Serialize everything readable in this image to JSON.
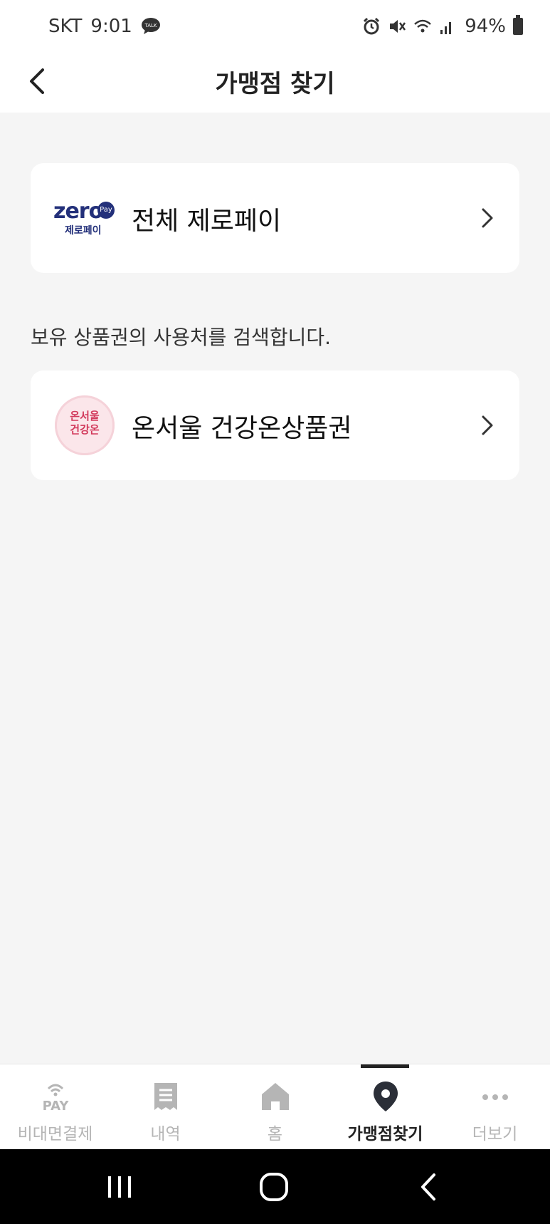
{
  "status_bar": {
    "carrier": "SKT",
    "time": "9:01",
    "battery_percent": "94%",
    "icons": [
      "talk-icon",
      "alarm-icon",
      "mute-icon",
      "wifi-icon",
      "signal-icon",
      "battery-icon"
    ]
  },
  "header": {
    "title": "가맹점 찾기",
    "back_icon": "chevron-left-icon"
  },
  "cards": {
    "zero": {
      "label": "전체 제로페이",
      "logo_word": "zero",
      "logo_pay": "Pay",
      "logo_sub": "제로페이",
      "chevron_icon": "chevron-right-icon"
    },
    "description": "보유 상품권의 사용처를 검색합니다.",
    "onseoul": {
      "label": "온서울 건강온상품권",
      "logo_line1": "온서울",
      "logo_line2": "건강온",
      "chevron_icon": "chevron-right-icon"
    }
  },
  "tabbar": {
    "active_index": 3,
    "tabs": [
      {
        "label": "비대면결제",
        "icon": "pay-icon"
      },
      {
        "label": "내역",
        "icon": "receipt-icon"
      },
      {
        "label": "홈",
        "icon": "home-icon"
      },
      {
        "label": "가맹점찾기",
        "icon": "location-pin-icon"
      },
      {
        "label": "더보기",
        "icon": "more-dots-icon"
      }
    ],
    "pay_icon_text": "PAY"
  },
  "navbar": {
    "buttons": [
      "recent-apps-icon",
      "home-circle-icon",
      "back-icon"
    ]
  },
  "colors": {
    "background": "#f5f5f5",
    "zero_brand": "#23307a",
    "onseoul_brand": "#d23a5c",
    "tab_inactive": "#b5b5b5",
    "tab_active": "#222222"
  }
}
